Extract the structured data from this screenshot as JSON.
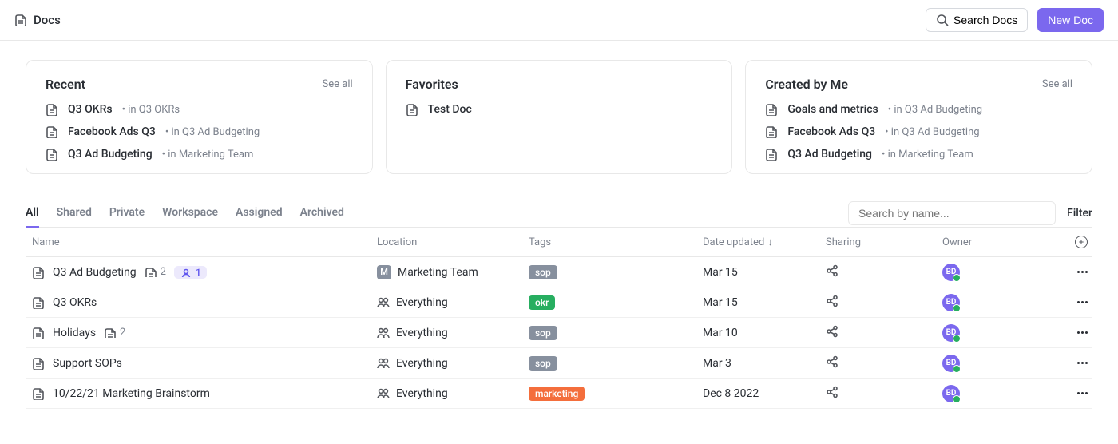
{
  "header": {
    "title": "Docs",
    "search_label": "Search Docs",
    "new_doc_label": "New Doc"
  },
  "cards": {
    "recent": {
      "title": "Recent",
      "see_all": "See all",
      "items": [
        {
          "name": "Q3 OKRs",
          "sub": "• in Q3 OKRs"
        },
        {
          "name": "Facebook Ads Q3",
          "sub": "• in Q3 Ad Budgeting"
        },
        {
          "name": "Q3 Ad Budgeting",
          "sub": "• in Marketing Team"
        }
      ]
    },
    "favorites": {
      "title": "Favorites",
      "items": [
        {
          "name": "Test Doc",
          "sub": ""
        }
      ]
    },
    "created": {
      "title": "Created by Me",
      "see_all": "See all",
      "items": [
        {
          "name": "Goals and metrics",
          "sub": "• in Q3 Ad Budgeting"
        },
        {
          "name": "Facebook Ads Q3",
          "sub": "• in Q3 Ad Budgeting"
        },
        {
          "name": "Q3 Ad Budgeting",
          "sub": "• in Marketing Team"
        }
      ]
    }
  },
  "tabs": [
    "All",
    "Shared",
    "Private",
    "Workspace",
    "Assigned",
    "Archived"
  ],
  "active_tab": "All",
  "search_placeholder": "Search by name...",
  "filter_label": "Filter",
  "columns": {
    "name": "Name",
    "location": "Location",
    "tags": "Tags",
    "date": "Date updated",
    "sharing": "Sharing",
    "owner": "Owner"
  },
  "tag_colors": {
    "sop": "#87909e",
    "okr": "#27ae60",
    "marketing": "#f46e3c"
  },
  "owner_initials": "BD",
  "rows": [
    {
      "name": "Q3 Ad Budgeting",
      "page_count": "2",
      "contrib": "1",
      "loc_kind": "space",
      "loc_initial": "M",
      "location": "Marketing Team",
      "tag": "sop",
      "date": "Mar 15"
    },
    {
      "name": "Q3 OKRs",
      "loc_kind": "everything",
      "location": "Everything",
      "tag": "okr",
      "date": "Mar 15"
    },
    {
      "name": "Holidays",
      "page_count": "2",
      "loc_kind": "everything",
      "location": "Everything",
      "tag": "sop",
      "date": "Mar 10"
    },
    {
      "name": "Support SOPs",
      "loc_kind": "everything",
      "location": "Everything",
      "tag": "sop",
      "date": "Mar 3"
    },
    {
      "name": "10/22/21 Marketing Brainstorm",
      "loc_kind": "everything",
      "location": "Everything",
      "tag": "marketing",
      "date": "Dec 8 2022"
    }
  ]
}
